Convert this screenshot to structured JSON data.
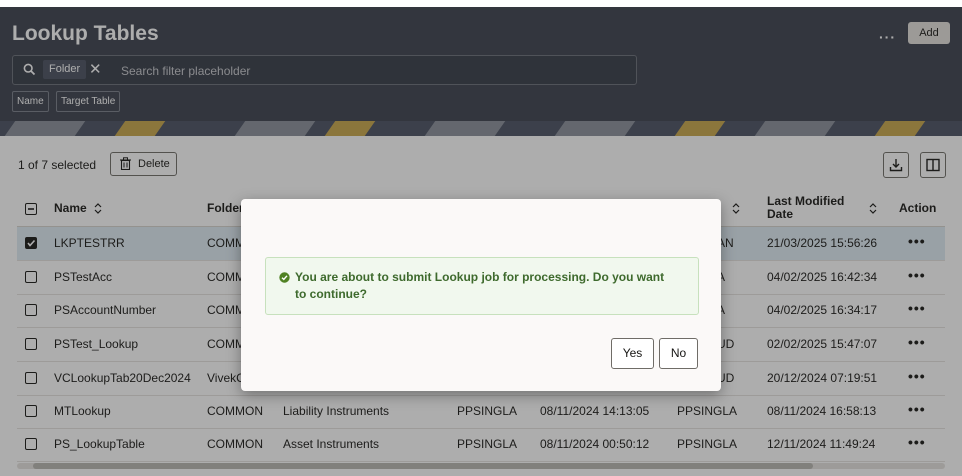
{
  "header": {
    "title": "Lookup Tables",
    "more_label": "···",
    "add_label": "Add"
  },
  "search": {
    "chip_label": "Folder",
    "chip_remove": "✕",
    "placeholder": "Search filter placeholder"
  },
  "filter_pills": [
    "Name",
    "Target Table"
  ],
  "toolbar": {
    "selected_text": "1 of 7 selected",
    "delete_label": "Delete"
  },
  "table": {
    "columns": {
      "name": "Name",
      "folder": "Folder",
      "last_modified_date": "Last Modified Date",
      "action": "Action"
    },
    "rows": [
      {
        "name": "LKPTESTRR",
        "folder": "COMMON",
        "category": "",
        "created_by": "",
        "created_date": "",
        "modified_by": "AN",
        "modified_date": "21/03/2025 15:56:26",
        "selected": true
      },
      {
        "name": "PSTestAcc",
        "folder": "COMM",
        "category": "",
        "created_by": "",
        "created_date": "",
        "modified_by": "A",
        "modified_date": "04/02/2025 16:42:34",
        "selected": false
      },
      {
        "name": "PSAccountNumber",
        "folder": "COMM",
        "category": "",
        "created_by": "",
        "created_date": "",
        "modified_by": "A",
        "modified_date": "04/02/2025 16:34:17",
        "selected": false
      },
      {
        "name": "PSTest_Lookup",
        "folder": "COMM",
        "category": "",
        "created_by": "",
        "created_date": "",
        "modified_by": "UD",
        "modified_date": "02/02/2025 15:47:07",
        "selected": false
      },
      {
        "name": "VCLookupTab20Dec2024",
        "folder": "VivekC",
        "category": "",
        "created_by": "",
        "created_date": "",
        "modified_by": "UD",
        "modified_date": "20/12/2024 07:19:51",
        "selected": false
      },
      {
        "name": "MTLookup",
        "folder": "COMMON",
        "category": "Liability Instruments",
        "created_by": "PPSINGLA",
        "created_date": "08/11/2024 14:13:05",
        "modified_by": "PPSINGLA",
        "modified_date": "08/11/2024 16:58:13",
        "selected": false
      },
      {
        "name": "PS_LookupTable",
        "folder": "COMMON",
        "category": "Asset Instruments",
        "created_by": "PPSINGLA",
        "created_date": "08/11/2024 00:50:12",
        "modified_by": "PPSINGLA",
        "modified_date": "12/11/2024 11:49:24",
        "selected": false
      }
    ],
    "action_glyph": "•••"
  },
  "dialog": {
    "message": "You are about to submit Lookup job for processing. Do you want to continue?",
    "yes_label": "Yes",
    "no_label": "No"
  }
}
